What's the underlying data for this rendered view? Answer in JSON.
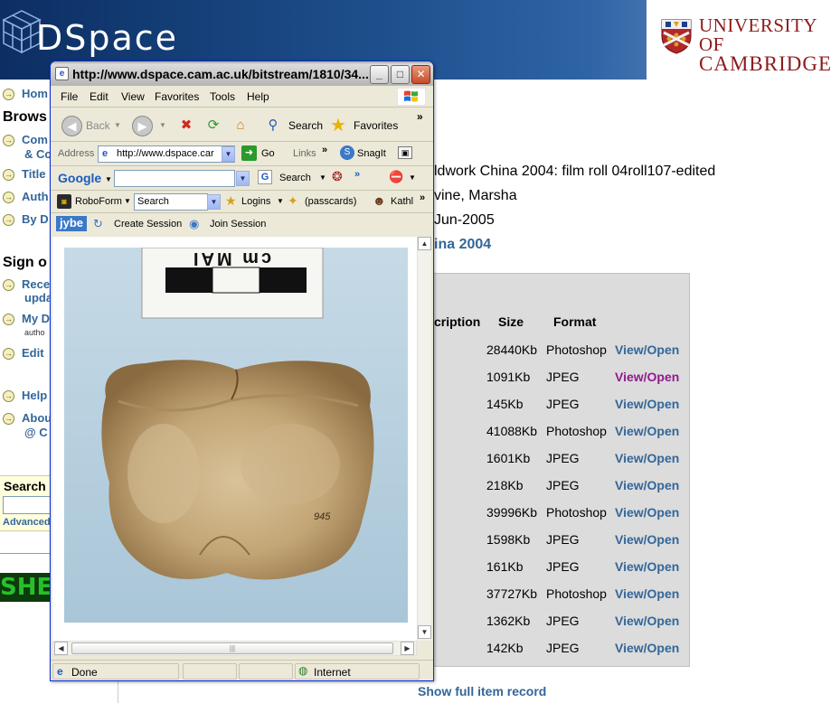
{
  "header": {
    "logo": "DSpace",
    "institution_line1": "UNIVERSITY OF",
    "institution_line2": "CAMBRIDGE"
  },
  "left_nav": {
    "items": [
      {
        "label": "Hom"
      },
      {
        "label": "Com"
      },
      {
        "label": "& Co"
      },
      {
        "label": "Title"
      },
      {
        "label": "Auth"
      },
      {
        "label": "By D"
      },
      {
        "label": "Rece"
      },
      {
        "label": "upda"
      },
      {
        "label": "My D"
      },
      {
        "label": "autho"
      },
      {
        "label": "Edit"
      },
      {
        "label": "Help"
      },
      {
        "label": "Abou"
      },
      {
        "label": "@ C"
      }
    ],
    "browse_heading": "Brows",
    "signon_heading": "Sign o",
    "search_heading": "Search",
    "advanced_label": "Advanced",
    "she_logo_text": "SHE"
  },
  "item": {
    "title_fragment": "ldwork China 2004: film roll 04roll107-edited",
    "author_fragment": "vine, Marsha",
    "date_fragment": "Jun-2005",
    "collection_fragment": "ina 2004"
  },
  "files_table": {
    "headers": {
      "description": "cription",
      "size": "Size",
      "format": "Format"
    },
    "rows": [
      {
        "size": "28440Kb",
        "format": "Photoshop",
        "link": "View/Open",
        "visited": false
      },
      {
        "size": "1091Kb",
        "format": "JPEG",
        "link": "View/Open",
        "visited": true
      },
      {
        "size": "145Kb",
        "format": "JPEG",
        "link": "View/Open",
        "visited": false
      },
      {
        "size": "41088Kb",
        "format": "Photoshop",
        "link": "View/Open",
        "visited": false
      },
      {
        "size": "1601Kb",
        "format": "JPEG",
        "link": "View/Open",
        "visited": false
      },
      {
        "size": "218Kb",
        "format": "JPEG",
        "link": "View/Open",
        "visited": false
      },
      {
        "size": "39996Kb",
        "format": "Photoshop",
        "link": "View/Open",
        "visited": false
      },
      {
        "size": "1598Kb",
        "format": "JPEG",
        "link": "View/Open",
        "visited": false
      },
      {
        "size": "161Kb",
        "format": "JPEG",
        "link": "View/Open",
        "visited": false
      },
      {
        "size": "37727Kb",
        "format": "Photoshop",
        "link": "View/Open",
        "visited": false
      },
      {
        "size": "1362Kb",
        "format": "JPEG",
        "link": "View/Open",
        "visited": false
      },
      {
        "size": "142Kb",
        "format": "JPEG",
        "link": "View/Open",
        "visited": false
      }
    ],
    "show_full_record": "Show full item record"
  },
  "ie_window": {
    "title": "http://www.dspace.cam.ac.uk/bitstream/1810/34...",
    "menus": [
      "File",
      "Edit",
      "View",
      "Favorites",
      "Tools",
      "Help"
    ],
    "toolbar": {
      "back": "Back",
      "search": "Search",
      "favorites": "Favorites"
    },
    "address": {
      "label": "Address",
      "value": "http://www.dspace.car",
      "go": "Go",
      "links": "Links",
      "snagit": "SnagIt"
    },
    "google": {
      "brand": "Google",
      "search": "Search"
    },
    "roboform": {
      "brand": "RoboForm",
      "search_value": "Search",
      "logins": "Logins",
      "passcards": "(passcards)",
      "user": "Kathl"
    },
    "jybe": {
      "brand": "jybe",
      "create": "Create Session",
      "join": "Join Session"
    },
    "status": {
      "left": "Done",
      "zone": "Internet"
    },
    "photo_scale_text": "cm  MAI",
    "photo_specimen_label": "945"
  },
  "colors": {
    "link": "#336699",
    "visited_link": "#8e1b8e",
    "header_blue": "#1e4f8c",
    "cambridge_red": "#8e1b1b",
    "xp_frame": "#0831d9"
  }
}
